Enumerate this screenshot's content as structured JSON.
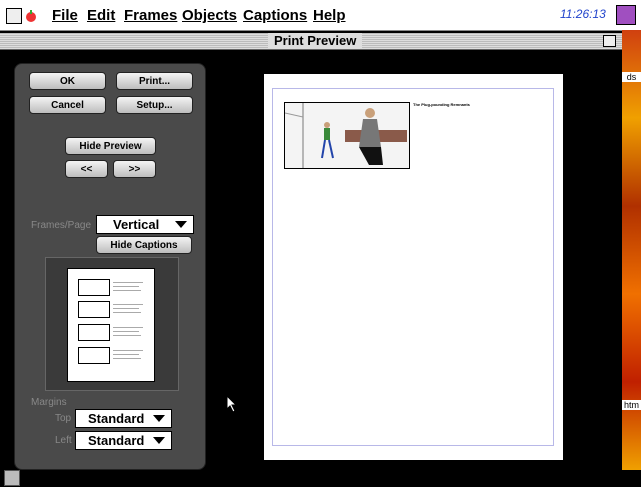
{
  "menu": {
    "items": [
      "File",
      "Edit",
      "Frames",
      "Objects",
      "Captions",
      "Help"
    ],
    "clock": "11:26:13"
  },
  "window": {
    "title": "Print Preview"
  },
  "desktop": {
    "label_top": "ds",
    "label_bottom": "htm"
  },
  "panel": {
    "ok": "OK",
    "print": "Print...",
    "cancel": "Cancel",
    "setup": "Setup...",
    "hide_preview": "Hide Preview",
    "prev": "<<",
    "next": ">>",
    "frames_per_page_label": "Frames/Page",
    "frames_per_page_value": "Vertical",
    "hide_captions": "Hide Captions",
    "margins_label": "Margins",
    "top_label": "Top",
    "top_value": "Standard",
    "left_label": "Left",
    "left_value": "Standard"
  },
  "preview": {
    "caption": "The Plug-pounding Remnants"
  },
  "colors": {
    "panel": "#4a4a4a",
    "clock": "#2244cc",
    "page_margin": "#b8b8e8"
  }
}
